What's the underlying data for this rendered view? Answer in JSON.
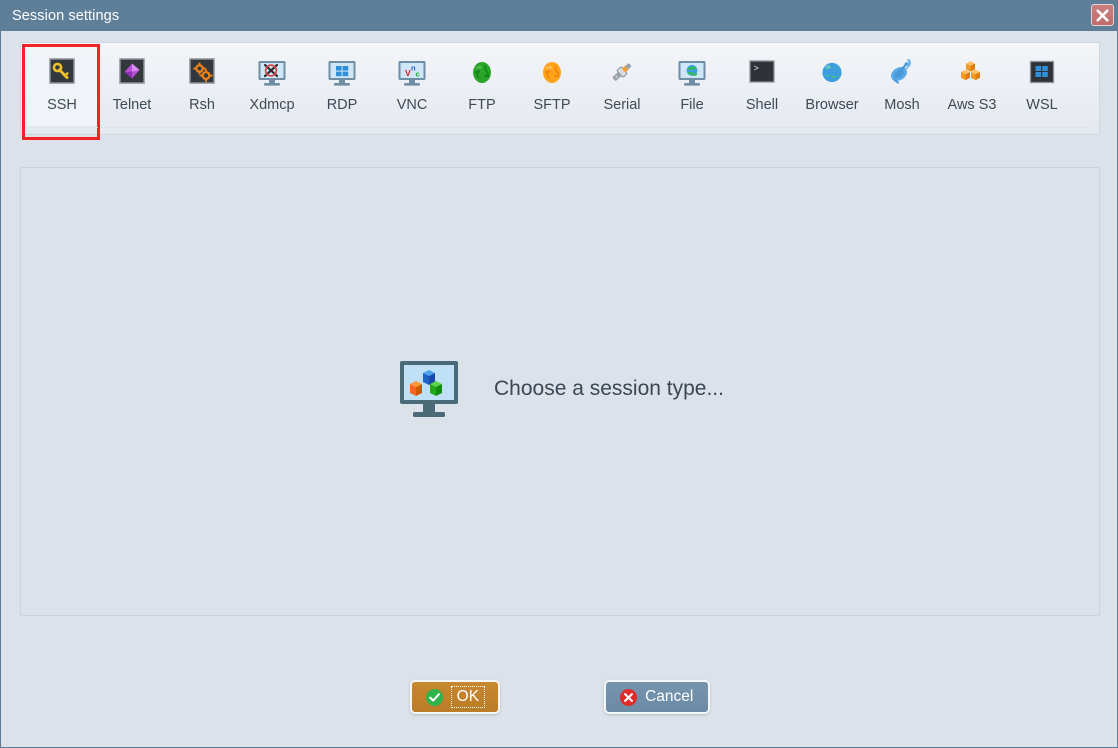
{
  "window": {
    "title": "Session settings",
    "close_icon": "close-x-icon",
    "title_bar_color": "#5f7f99",
    "background_color": "#dce2e9"
  },
  "toolbar": {
    "selected_index": 0,
    "selection_highlight_color": "#f42222",
    "items": [
      {
        "label": "SSH",
        "icon": "key-icon",
        "selected": true
      },
      {
        "label": "Telnet",
        "icon": "purple-gem-icon",
        "selected": false
      },
      {
        "label": "Rsh",
        "icon": "orange-gears-icon",
        "selected": false
      },
      {
        "label": "Xdmcp",
        "icon": "monitor-x-logo-icon",
        "selected": false
      },
      {
        "label": "RDP",
        "icon": "monitor-windows-icon",
        "selected": false
      },
      {
        "label": "VNC",
        "icon": "monitor-vnc-icon",
        "selected": false
      },
      {
        "label": "FTP",
        "icon": "green-globe-icon",
        "selected": false
      },
      {
        "label": "SFTP",
        "icon": "orange-globe-icon",
        "selected": false
      },
      {
        "label": "Serial",
        "icon": "serial-plug-icon",
        "selected": false
      },
      {
        "label": "File",
        "icon": "monitor-globe-icon",
        "selected": false
      },
      {
        "label": "Shell",
        "icon": "terminal-prompt-icon",
        "selected": false
      },
      {
        "label": "Browser",
        "icon": "blue-globe-icon",
        "selected": false
      },
      {
        "label": "Mosh",
        "icon": "satellite-dish-icon",
        "selected": false
      },
      {
        "label": "Aws S3",
        "icon": "aws-cubes-icon",
        "selected": false
      },
      {
        "label": "WSL",
        "icon": "windows-square-icon",
        "selected": false
      }
    ]
  },
  "content": {
    "placeholder_icon": "monitor-cubes-icon",
    "placeholder_text": "Choose a session type..."
  },
  "footer": {
    "ok_label": "OK",
    "ok_icon": "green-check-icon",
    "ok_color": "#c8882f",
    "cancel_label": "Cancel",
    "cancel_icon": "red-x-icon",
    "cancel_color": "#7694ad"
  }
}
